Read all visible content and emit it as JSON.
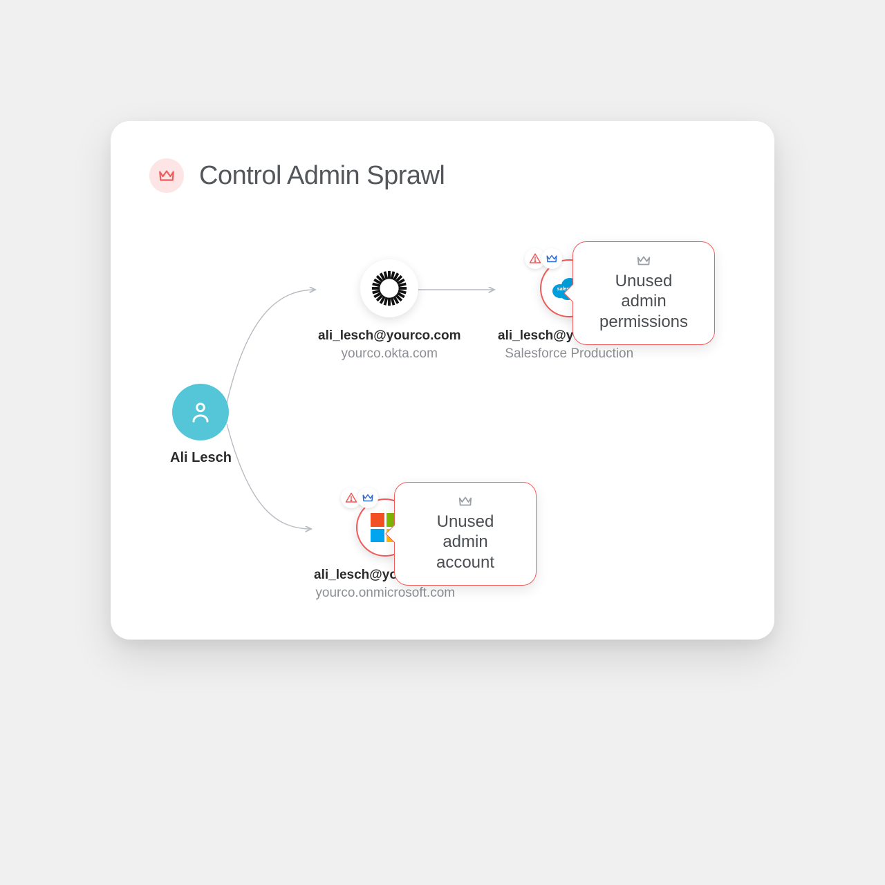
{
  "header": {
    "title": "Control Admin Sprawl"
  },
  "user": {
    "name": "Ali Lesch"
  },
  "nodes": {
    "okta": {
      "email": "ali_lesch@yourco.com",
      "domain": "yourco.okta.com"
    },
    "salesforce": {
      "email": "ali_lesch@yourco.com",
      "domain": "Salesforce Production"
    },
    "microsoft": {
      "email": "ali_lesch@yourco.com",
      "domain": "yourco.onmicrosoft.com"
    }
  },
  "callouts": {
    "salesforce": "Unused admin permissions",
    "microsoft": "Unused admin account"
  },
  "colors": {
    "alert": "#f15b5b",
    "crown_blue": "#2f6bd6",
    "crown_gray": "#9aa0a6",
    "user_teal": "#55c5d8"
  }
}
